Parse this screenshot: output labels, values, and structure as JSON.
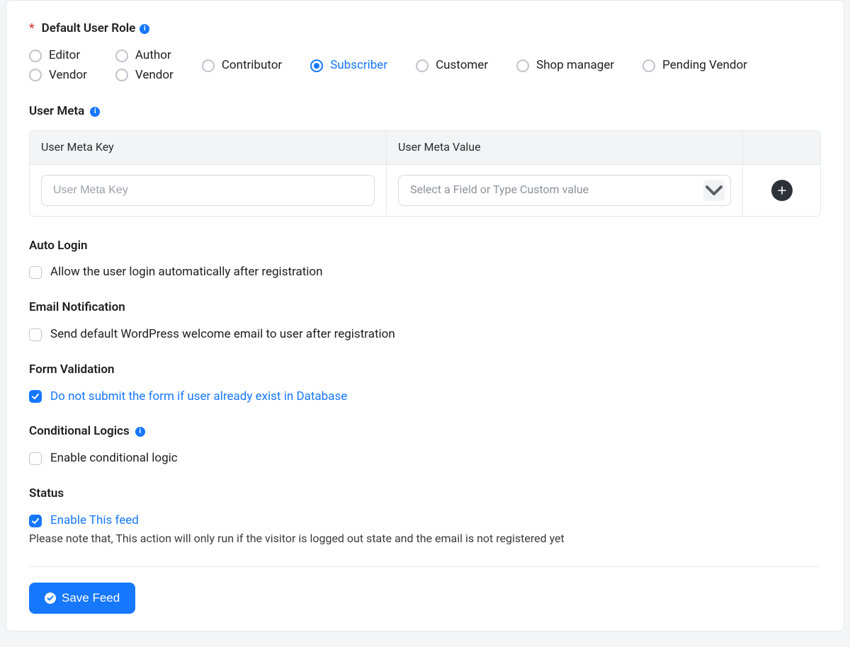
{
  "defaultUserRole": {
    "label": "Default User Role",
    "options": {
      "editor": "Editor",
      "author": "Author",
      "contributor": "Contributor",
      "subscriber": "Subscriber",
      "customer": "Customer",
      "shop_manager": "Shop manager",
      "pending_vendor": "Pending Vendor",
      "vendor": "Vendor",
      "vendor2": "Vendor"
    },
    "selected": "subscriber"
  },
  "userMeta": {
    "heading": "User Meta",
    "headers": {
      "key": "User Meta Key",
      "value": "User Meta Value"
    },
    "keyPlaceholder": "User Meta Key",
    "valuePlaceholder": "Select a Field or Type Custom value"
  },
  "autoLogin": {
    "heading": "Auto Login",
    "label": "Allow the user login automatically after registration",
    "checked": false
  },
  "emailNotification": {
    "heading": "Email Notification",
    "label": "Send default WordPress welcome email to user after registration",
    "checked": false
  },
  "formValidation": {
    "heading": "Form Validation",
    "label": "Do not submit the form if user already exist in Database",
    "checked": true
  },
  "conditionalLogics": {
    "heading": "Conditional Logics",
    "label": "Enable conditional logic",
    "checked": false
  },
  "status": {
    "heading": "Status",
    "label": "Enable This feed",
    "checked": true,
    "note": "Please note that, This action will only run if the visitor is logged out state and the email is not registered yet"
  },
  "saveButton": "Save Feed"
}
